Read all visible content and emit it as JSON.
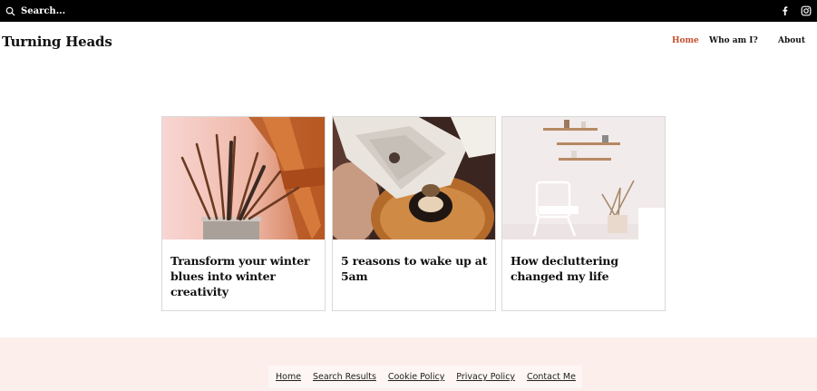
{
  "topbar": {
    "search_placeholder": "Search...",
    "social_icons": [
      "facebook-icon",
      "instagram-icon"
    ]
  },
  "header": {
    "logo": "Turning Heads",
    "nav": [
      {
        "label": "Home",
        "active": true
      },
      {
        "label": "Who am I?",
        "active": false
      },
      {
        "label": "About",
        "active": false
      }
    ]
  },
  "posts": [
    {
      "title": "Transform your winter blues into winter creativity"
    },
    {
      "title": "5 reasons to wake up at 5am"
    },
    {
      "title": "How decluttering changed my life"
    }
  ],
  "footer": {
    "links": [
      "Home",
      "Search Results",
      "Cookie Policy",
      "Privacy Policy",
      "Contact Me"
    ]
  },
  "colors": {
    "accent": "#c44e2d",
    "topbar": "#000000",
    "footer_bg": "#fbeeeb"
  }
}
